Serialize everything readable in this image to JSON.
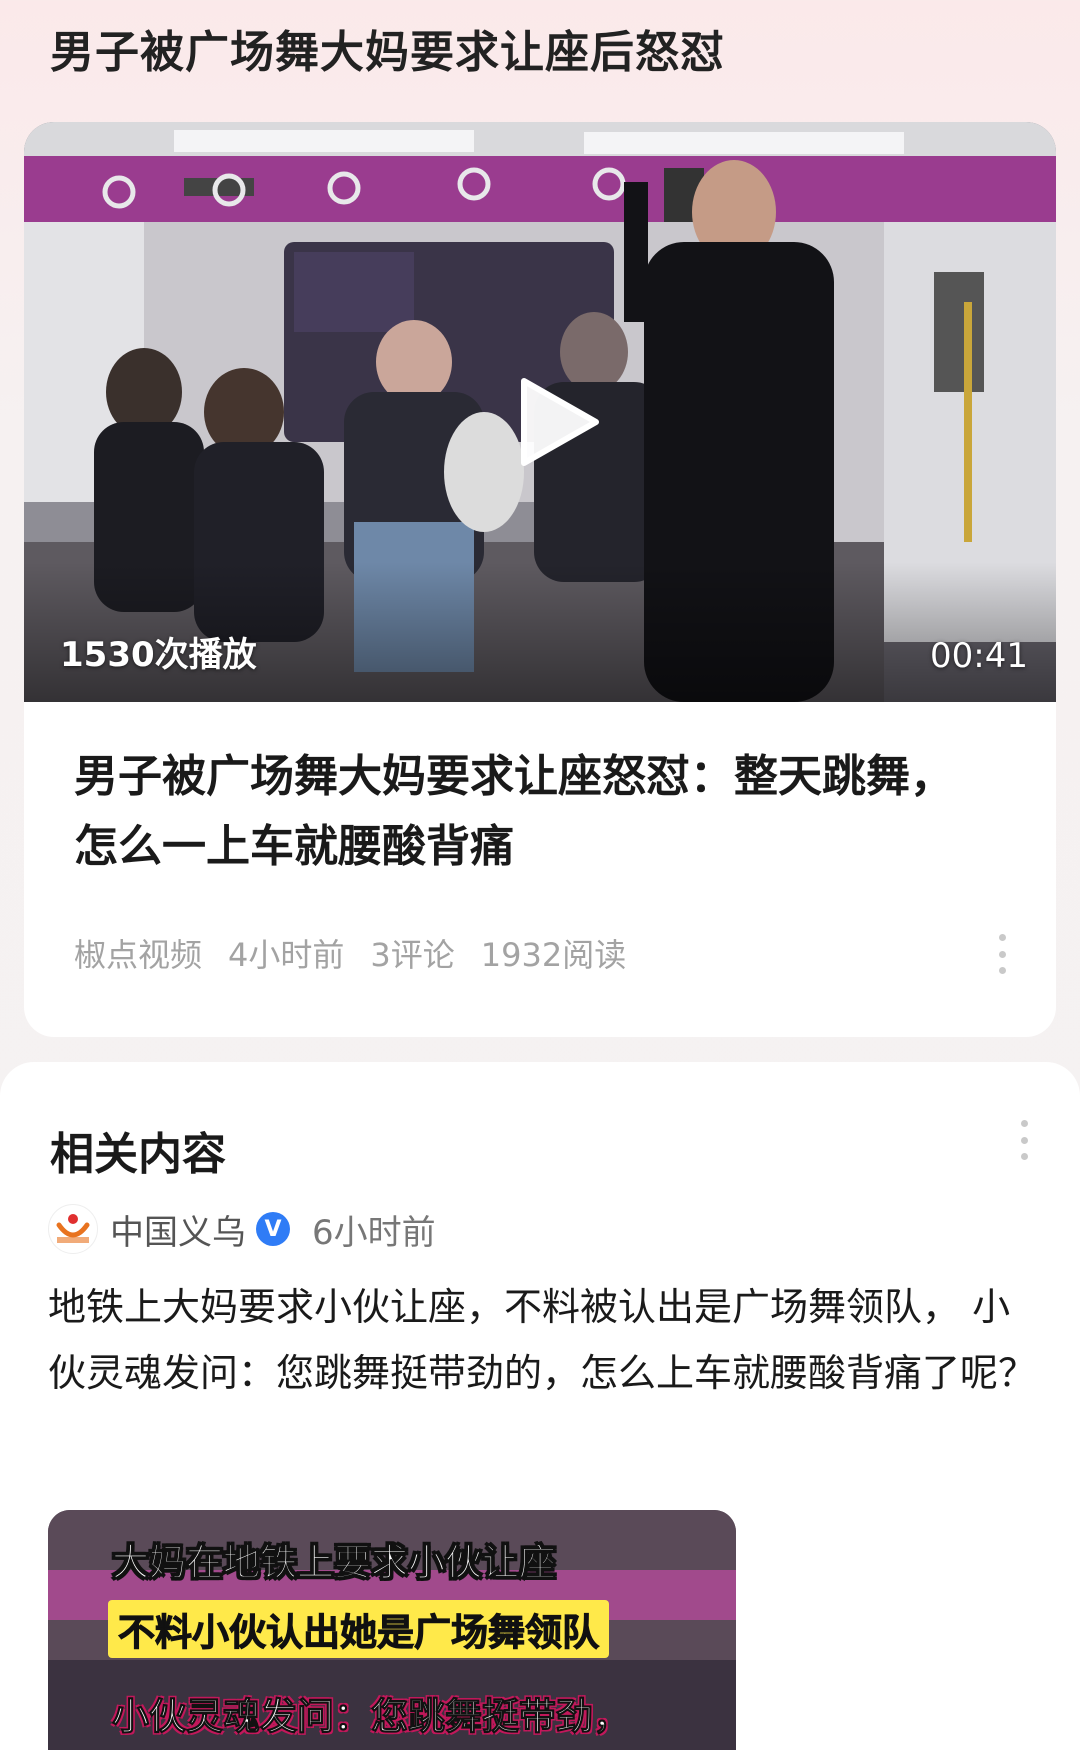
{
  "header": {
    "title": "男子被广场舞大妈要求让座后怒怼"
  },
  "video_card": {
    "play_count": "1530次播放",
    "duration": "00:41",
    "title": "男子被广场舞大妈要求让座怒怼：整天跳舞，怎么一上车就腰酸背痛",
    "meta": {
      "source": "椒点视频",
      "time": "4小时前",
      "comments": "3评论",
      "reads": "1932阅读"
    }
  },
  "related": {
    "heading": "相关内容",
    "item": {
      "source": "中国义乌",
      "verified_mark": "V",
      "time": "6小时前",
      "text": "地铁上大妈要求小伙让座，不料被认出是广场舞领队， 小伙灵魂发问：您跳舞挺带劲的，怎么上车就腰酸背痛了呢？",
      "thumb_lines": [
        "大妈在地铁上要求小伙让座",
        "不料小伙认出她是广场舞领队",
        "小伙灵魂发问：您跳舞挺带劲，"
      ]
    }
  },
  "icons": {
    "play": "play-icon",
    "more": "more-vertical-icon",
    "verified": "verified-badge-icon"
  },
  "colors": {
    "accent_verified": "#2f7cf6",
    "meta_gray": "#a3a3a3",
    "subway_purple": "#9a3c8f"
  }
}
